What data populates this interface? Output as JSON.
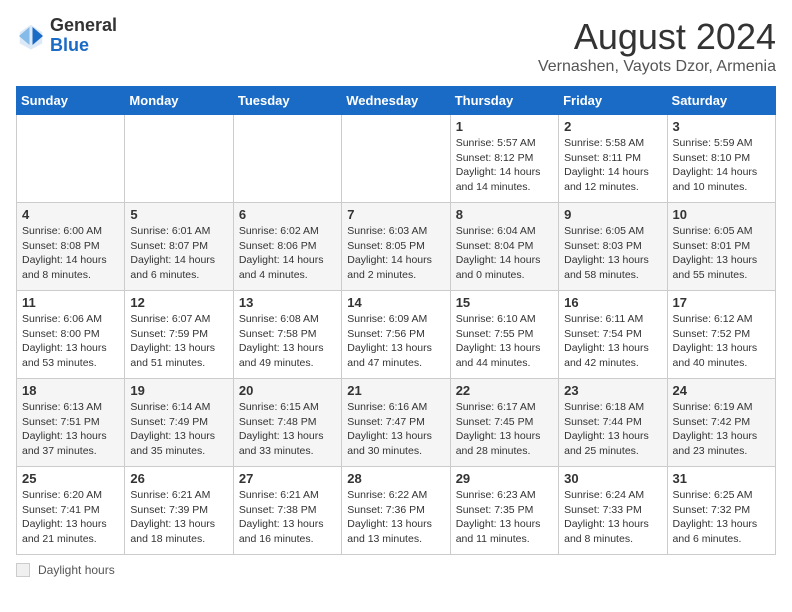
{
  "header": {
    "logo_general": "General",
    "logo_blue": "Blue",
    "month_title": "August 2024",
    "subtitle": "Vernashen, Vayots Dzor, Armenia"
  },
  "days_of_week": [
    "Sunday",
    "Monday",
    "Tuesday",
    "Wednesday",
    "Thursday",
    "Friday",
    "Saturday"
  ],
  "weeks": [
    [
      {
        "day": "",
        "info": ""
      },
      {
        "day": "",
        "info": ""
      },
      {
        "day": "",
        "info": ""
      },
      {
        "day": "",
        "info": ""
      },
      {
        "day": "1",
        "info": "Sunrise: 5:57 AM\nSunset: 8:12 PM\nDaylight: 14 hours and 14 minutes."
      },
      {
        "day": "2",
        "info": "Sunrise: 5:58 AM\nSunset: 8:11 PM\nDaylight: 14 hours and 12 minutes."
      },
      {
        "day": "3",
        "info": "Sunrise: 5:59 AM\nSunset: 8:10 PM\nDaylight: 14 hours and 10 minutes."
      }
    ],
    [
      {
        "day": "4",
        "info": "Sunrise: 6:00 AM\nSunset: 8:08 PM\nDaylight: 14 hours and 8 minutes."
      },
      {
        "day": "5",
        "info": "Sunrise: 6:01 AM\nSunset: 8:07 PM\nDaylight: 14 hours and 6 minutes."
      },
      {
        "day": "6",
        "info": "Sunrise: 6:02 AM\nSunset: 8:06 PM\nDaylight: 14 hours and 4 minutes."
      },
      {
        "day": "7",
        "info": "Sunrise: 6:03 AM\nSunset: 8:05 PM\nDaylight: 14 hours and 2 minutes."
      },
      {
        "day": "8",
        "info": "Sunrise: 6:04 AM\nSunset: 8:04 PM\nDaylight: 14 hours and 0 minutes."
      },
      {
        "day": "9",
        "info": "Sunrise: 6:05 AM\nSunset: 8:03 PM\nDaylight: 13 hours and 58 minutes."
      },
      {
        "day": "10",
        "info": "Sunrise: 6:05 AM\nSunset: 8:01 PM\nDaylight: 13 hours and 55 minutes."
      }
    ],
    [
      {
        "day": "11",
        "info": "Sunrise: 6:06 AM\nSunset: 8:00 PM\nDaylight: 13 hours and 53 minutes."
      },
      {
        "day": "12",
        "info": "Sunrise: 6:07 AM\nSunset: 7:59 PM\nDaylight: 13 hours and 51 minutes."
      },
      {
        "day": "13",
        "info": "Sunrise: 6:08 AM\nSunset: 7:58 PM\nDaylight: 13 hours and 49 minutes."
      },
      {
        "day": "14",
        "info": "Sunrise: 6:09 AM\nSunset: 7:56 PM\nDaylight: 13 hours and 47 minutes."
      },
      {
        "day": "15",
        "info": "Sunrise: 6:10 AM\nSunset: 7:55 PM\nDaylight: 13 hours and 44 minutes."
      },
      {
        "day": "16",
        "info": "Sunrise: 6:11 AM\nSunset: 7:54 PM\nDaylight: 13 hours and 42 minutes."
      },
      {
        "day": "17",
        "info": "Sunrise: 6:12 AM\nSunset: 7:52 PM\nDaylight: 13 hours and 40 minutes."
      }
    ],
    [
      {
        "day": "18",
        "info": "Sunrise: 6:13 AM\nSunset: 7:51 PM\nDaylight: 13 hours and 37 minutes."
      },
      {
        "day": "19",
        "info": "Sunrise: 6:14 AM\nSunset: 7:49 PM\nDaylight: 13 hours and 35 minutes."
      },
      {
        "day": "20",
        "info": "Sunrise: 6:15 AM\nSunset: 7:48 PM\nDaylight: 13 hours and 33 minutes."
      },
      {
        "day": "21",
        "info": "Sunrise: 6:16 AM\nSunset: 7:47 PM\nDaylight: 13 hours and 30 minutes."
      },
      {
        "day": "22",
        "info": "Sunrise: 6:17 AM\nSunset: 7:45 PM\nDaylight: 13 hours and 28 minutes."
      },
      {
        "day": "23",
        "info": "Sunrise: 6:18 AM\nSunset: 7:44 PM\nDaylight: 13 hours and 25 minutes."
      },
      {
        "day": "24",
        "info": "Sunrise: 6:19 AM\nSunset: 7:42 PM\nDaylight: 13 hours and 23 minutes."
      }
    ],
    [
      {
        "day": "25",
        "info": "Sunrise: 6:20 AM\nSunset: 7:41 PM\nDaylight: 13 hours and 21 minutes."
      },
      {
        "day": "26",
        "info": "Sunrise: 6:21 AM\nSunset: 7:39 PM\nDaylight: 13 hours and 18 minutes."
      },
      {
        "day": "27",
        "info": "Sunrise: 6:21 AM\nSunset: 7:38 PM\nDaylight: 13 hours and 16 minutes."
      },
      {
        "day": "28",
        "info": "Sunrise: 6:22 AM\nSunset: 7:36 PM\nDaylight: 13 hours and 13 minutes."
      },
      {
        "day": "29",
        "info": "Sunrise: 6:23 AM\nSunset: 7:35 PM\nDaylight: 13 hours and 11 minutes."
      },
      {
        "day": "30",
        "info": "Sunrise: 6:24 AM\nSunset: 7:33 PM\nDaylight: 13 hours and 8 minutes."
      },
      {
        "day": "31",
        "info": "Sunrise: 6:25 AM\nSunset: 7:32 PM\nDaylight: 13 hours and 6 minutes."
      }
    ]
  ],
  "legend": {
    "label": "Daylight hours"
  }
}
